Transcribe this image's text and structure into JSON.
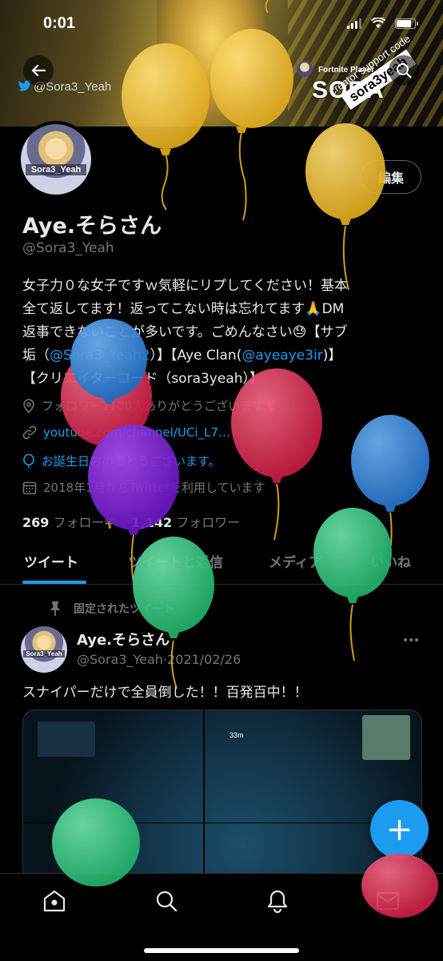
{
  "status_bar": {
    "time": "0:01",
    "battery_level": 0.85
  },
  "banner": {
    "handle": "@Sora3_Yeah",
    "fortnite_label": "Fortnite Player",
    "sora_title": "SORA",
    "code_label": "creator support code",
    "code": "sora3yeah"
  },
  "profile": {
    "avatar_label": "Sora3_Yeah",
    "edit_button": "編集",
    "display_name": "Aye.そらさん",
    "handle": "@Sora3_Yeah",
    "bio": {
      "line1": "女子力０な女子ですｗ気軽にリプしてください！基本",
      "line2": "全て返してます！返ってこない時は忘れてます🙏DM",
      "line3": "返事できないことが多いです。ごめんなさい😓【サブ",
      "line4_a": "垢（",
      "line4_link1": "@Sora3_Yeah2",
      "line4_b": "）】【Aye Clan(",
      "line4_link2": "@ayeaye3ir",
      "line4_c": ")】",
      "line5": "【クリエイターコード（sora3yeah）】"
    },
    "location": "フォロワー1100人ありがとうございます🌹",
    "website": "youtube.com/channel/UCi_L7…",
    "birthday": "お誕生日おめでとうございます。",
    "joined": "2018年1月からTwitterを利用しています",
    "following_count": "269",
    "following_label": "フォロー中",
    "followers_count": "1,142",
    "followers_label": "フォロワー"
  },
  "tabs": [
    "ツイート",
    "ツイートと返信",
    "メディア",
    "いいね"
  ],
  "tweet": {
    "pinned_label": "固定されたツイート",
    "avatar_label": "Sora3_Yeah",
    "name": "Aye.そらさん",
    "handle": "@Sora3_Yeah",
    "date": "2021/02/26",
    "text": "スナイパーだけで全員倒した！！百発百中！！",
    "media_hud": "33m"
  },
  "fab_label": "+",
  "nav": [
    "home-icon",
    "search-icon",
    "bell-icon",
    "mail-icon"
  ],
  "colors": {
    "accent": "#1d9bf0",
    "balloon_yellow": "#f0c436",
    "balloon_red": "#e8385a",
    "balloon_blue": "#3d8fe0",
    "balloon_purple": "#8a2be2",
    "balloon_green": "#3ad489"
  }
}
